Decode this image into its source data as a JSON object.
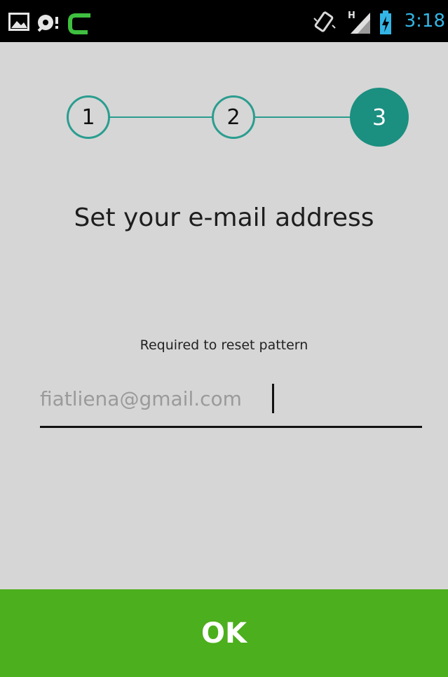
{
  "status_bar": {
    "time": "3:18",
    "left_icons": [
      "gallery-icon",
      "sync-notification-icon",
      "app-c-icon"
    ],
    "right_icons": [
      "vibrate-icon",
      "signal-h-icon",
      "battery-charging-icon"
    ],
    "network_type": "H"
  },
  "stepper": {
    "steps": [
      "1",
      "2",
      "3"
    ],
    "current_step": 3
  },
  "heading": "Set your e-mail address",
  "subtext": "Required to reset pattern",
  "email": {
    "value": "fiatliena@gmail.com"
  },
  "ok_button": {
    "label": "OK"
  },
  "colors": {
    "background": "#d6d6d6",
    "status_bar": "#000000",
    "time": "#33b5e5",
    "step_accent": "#2a9d8f",
    "step_active": "#1b8f80",
    "ok_button": "#4caf1d"
  }
}
